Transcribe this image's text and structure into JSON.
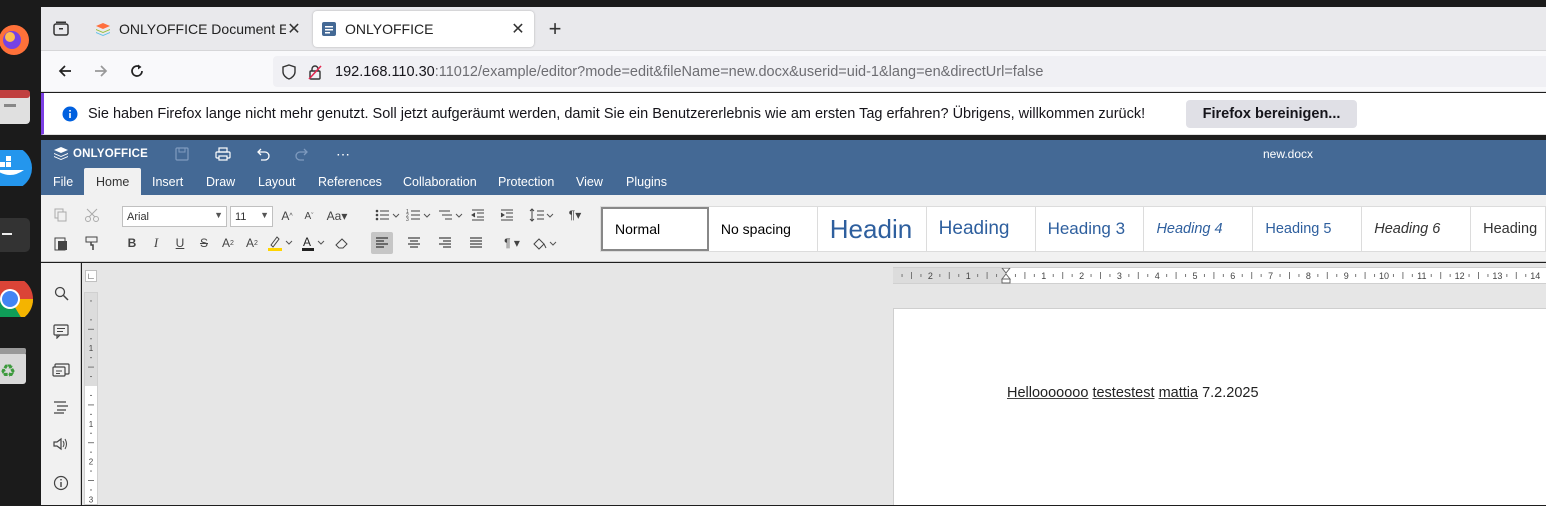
{
  "browser": {
    "tabs": [
      {
        "title": "ONLYOFFICE Document E",
        "active": false
      },
      {
        "title": "ONLYOFFICE",
        "active": true
      }
    ],
    "new_tab_label": "+",
    "url": {
      "host": "192.168.110.30",
      "rest": ":11012/example/editor?mode=edit&fileName=new.docx&userid=uid-1&lang=en&directUrl=false"
    },
    "notification": {
      "text": "Sie haben Firefox lange nicht mehr genutzt. Soll jetzt aufgeräumt werden, damit Sie ein Benutzererlebnis wie am ersten Tag erfahren? Übrigens, willkommen zurück!",
      "button": "Firefox bereinigen..."
    }
  },
  "editor": {
    "brand": "ONLYOFFICE",
    "file_name": "new.docx",
    "menu": [
      "File",
      "Home",
      "Insert",
      "Draw",
      "Layout",
      "References",
      "Collaboration",
      "Protection",
      "View",
      "Plugins"
    ],
    "active_menu": "Home",
    "font_name": "Arial",
    "font_size": "11",
    "styles": [
      "Normal",
      "No spacing",
      "Headin",
      "Heading",
      "Heading 3",
      "Heading 4",
      "Heading 5",
      "Heading 6",
      "Heading"
    ],
    "ruler_numbers": [
      "2",
      "1",
      "1",
      "2",
      "3",
      "4",
      "5",
      "6",
      "7",
      "8",
      "9",
      "10",
      "11",
      "12",
      "13",
      "14"
    ],
    "vruler_numbers": [
      "1",
      "1",
      "2",
      "3"
    ],
    "document": {
      "words": [
        "Hellooooooo",
        "testestest",
        "mattia",
        "7.2.2025"
      ]
    }
  },
  "colors": {
    "header": "#446995",
    "toolbar": "#f1f1f1",
    "workspace": "#e6e6e6",
    "style_blue": "#2e5f9e"
  }
}
